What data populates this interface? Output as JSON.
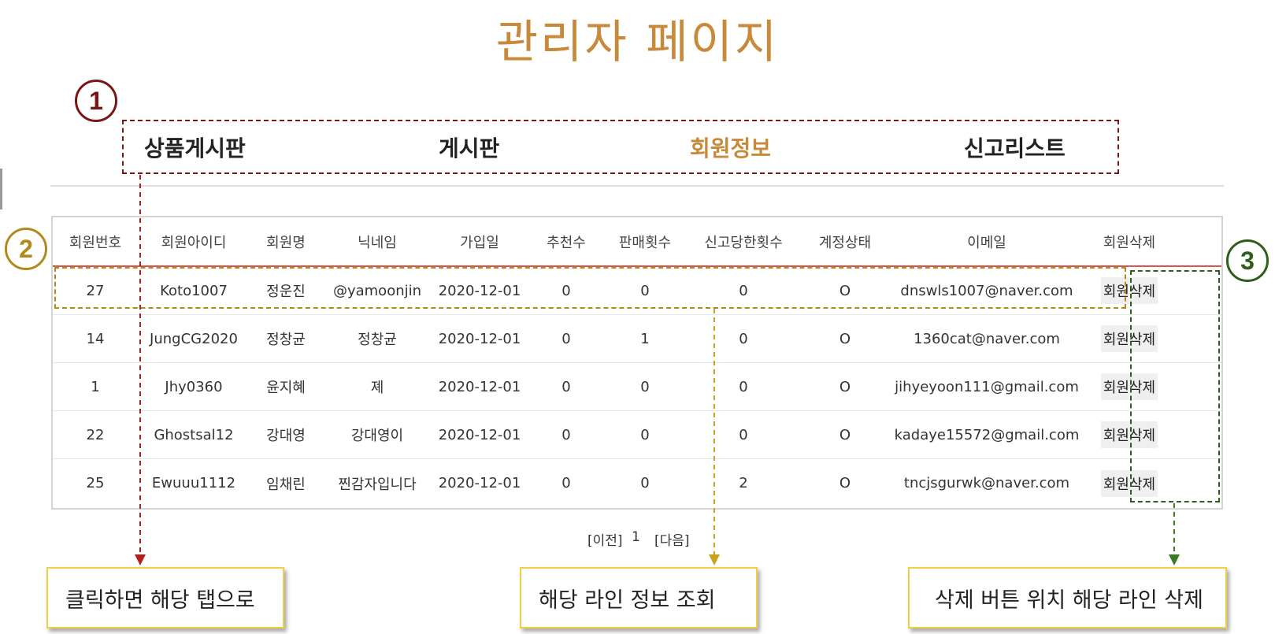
{
  "page_title": "관리자 페이지",
  "markers": [
    "1",
    "2",
    "3"
  ],
  "nav": {
    "items": [
      {
        "label": "상품게시판",
        "active": false
      },
      {
        "label": "게시판",
        "active": false
      },
      {
        "label": "회원정보",
        "active": true
      },
      {
        "label": "신고리스트",
        "active": false
      }
    ]
  },
  "table": {
    "columns": [
      "회원번호",
      "회원아이디",
      "회원명",
      "닉네임",
      "가입일",
      "추천수",
      "판매횟수",
      "신고당한횟수",
      "계정상태",
      "이메일",
      "회원삭제"
    ],
    "rows": [
      [
        "27",
        "Koto1007",
        "정운진",
        "@yamoonjin",
        "2020-12-01",
        "0",
        "0",
        "0",
        "O",
        "dnswls1007@naver.com",
        "회원삭제"
      ],
      [
        "14",
        "JungCG2020",
        "정창균",
        "정창균",
        "2020-12-01",
        "0",
        "1",
        "0",
        "O",
        "1360cat@naver.com",
        "회원삭제"
      ],
      [
        "1",
        "Jhy0360",
        "윤지혜",
        "졔",
        "2020-12-01",
        "0",
        "0",
        "0",
        "O",
        "jihyeyoon111@gmail.com",
        "회원삭제"
      ],
      [
        "22",
        "Ghostsal12",
        "강대영",
        "강대영이",
        "2020-12-01",
        "0",
        "0",
        "0",
        "O",
        "kadaye15572@gmail.com",
        "회원삭제"
      ],
      [
        "25",
        "Ewuuu1112",
        "임채린",
        "찐감자입니다",
        "2020-12-01",
        "0",
        "0",
        "2",
        "O",
        "tncjsgurwk@naver.com",
        "회원삭제"
      ]
    ]
  },
  "pagination": {
    "prev": "[이전]",
    "current": "1",
    "next": "[다음]"
  },
  "callouts": [
    "클릭하면 해당 탭으로",
    "해당 라인 정보 조회",
    "삭제 버튼 위치 해당 라인 삭제"
  ],
  "colors": {
    "accent": "#c8893a",
    "marker1": "#7a1616",
    "marker2": "#b08a1a",
    "marker3": "#2f5e1a",
    "header_rule": "#d9534f",
    "callout_border": "#f0d040"
  }
}
